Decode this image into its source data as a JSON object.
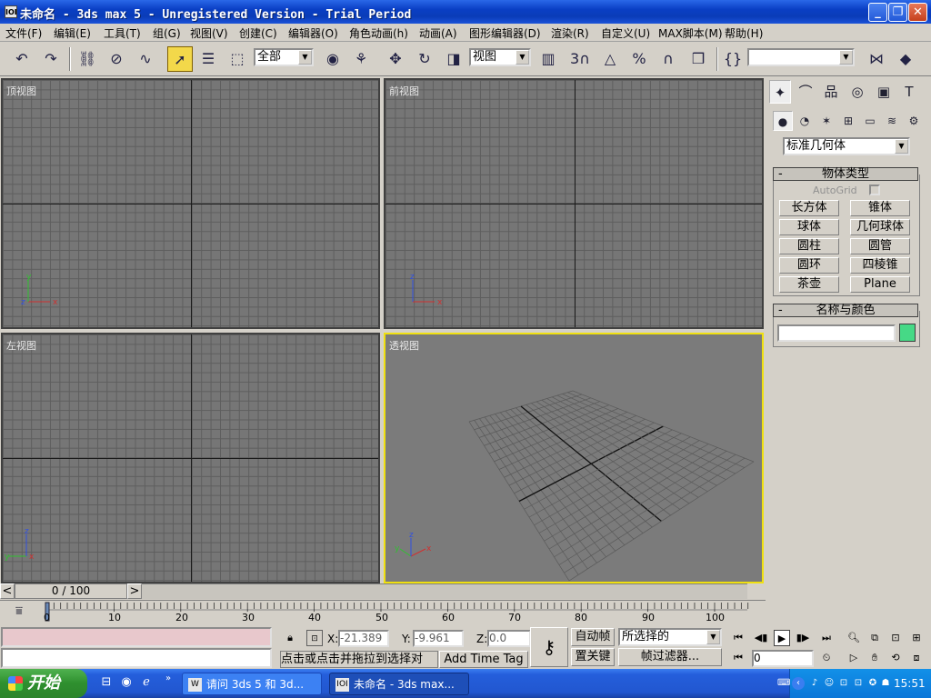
{
  "window": {
    "title": "未命名 - 3ds max 5 - Unregistered Version - Trial Period",
    "icon_text": "IOI",
    "minimize": "_",
    "maximize": "❐",
    "close": "✕"
  },
  "menu": [
    "文件(F)",
    "编辑(E)",
    "工具(T)",
    "组(G)",
    "视图(V)",
    "创建(C)",
    "编辑器(O)",
    "角色动画(h)",
    "动画(A)",
    "图形编辑器(D)",
    "渲染(R)",
    "自定义(U)",
    "MAX脚本(M)",
    "帮助(H)"
  ],
  "toolbar": {
    "selection_filter": "全部",
    "reference_coord": "视图",
    "named_selection": "",
    "snap_3d": "3"
  },
  "viewports": {
    "top": {
      "label": "顶视图"
    },
    "front": {
      "label": "前视图"
    },
    "left": {
      "label": "左视图"
    },
    "perspective": {
      "label": "透视图"
    },
    "axis_x": "x",
    "axis_y": "y",
    "axis_z": "z"
  },
  "command_panel": {
    "category": "标准几何体",
    "object_type_title": "物体类型",
    "autogrid_label": "AutoGrid",
    "buttons": [
      "长方体",
      "锥体",
      "球体",
      "几何球体",
      "圆柱",
      "圆管",
      "圆环",
      "四棱锥",
      "茶壶",
      "Plane"
    ],
    "name_color_title": "名称与颜色",
    "name_value": "",
    "object_color": "#46d986",
    "rollout_minus": "-"
  },
  "timeline": {
    "slider_label": "0 / 100",
    "ticks": [
      "0",
      "10",
      "20",
      "30",
      "40",
      "50",
      "60",
      "70",
      "80",
      "90",
      "100"
    ],
    "prev": "<",
    "next": ">"
  },
  "status": {
    "x_label": "X:",
    "x_value": "-21.389",
    "y_label": "Y:",
    "y_value": "-9.961",
    "z_label": "Z:",
    "z_value": "0.0",
    "prompt": "点击或点击并拖拉到选择对",
    "add_time_tag": "Add Time Tag",
    "auto_key": "自动帧",
    "set_key": "置关键",
    "key_mode": "所选择的",
    "key_filters": "帧过滤器...",
    "frame": "0"
  },
  "taskbar": {
    "start": "开始",
    "tasks": [
      "请问 3ds 5 和 3d...",
      "未命名 - 3ds max..."
    ],
    "clock": "15:51",
    "quick_more": "»"
  }
}
